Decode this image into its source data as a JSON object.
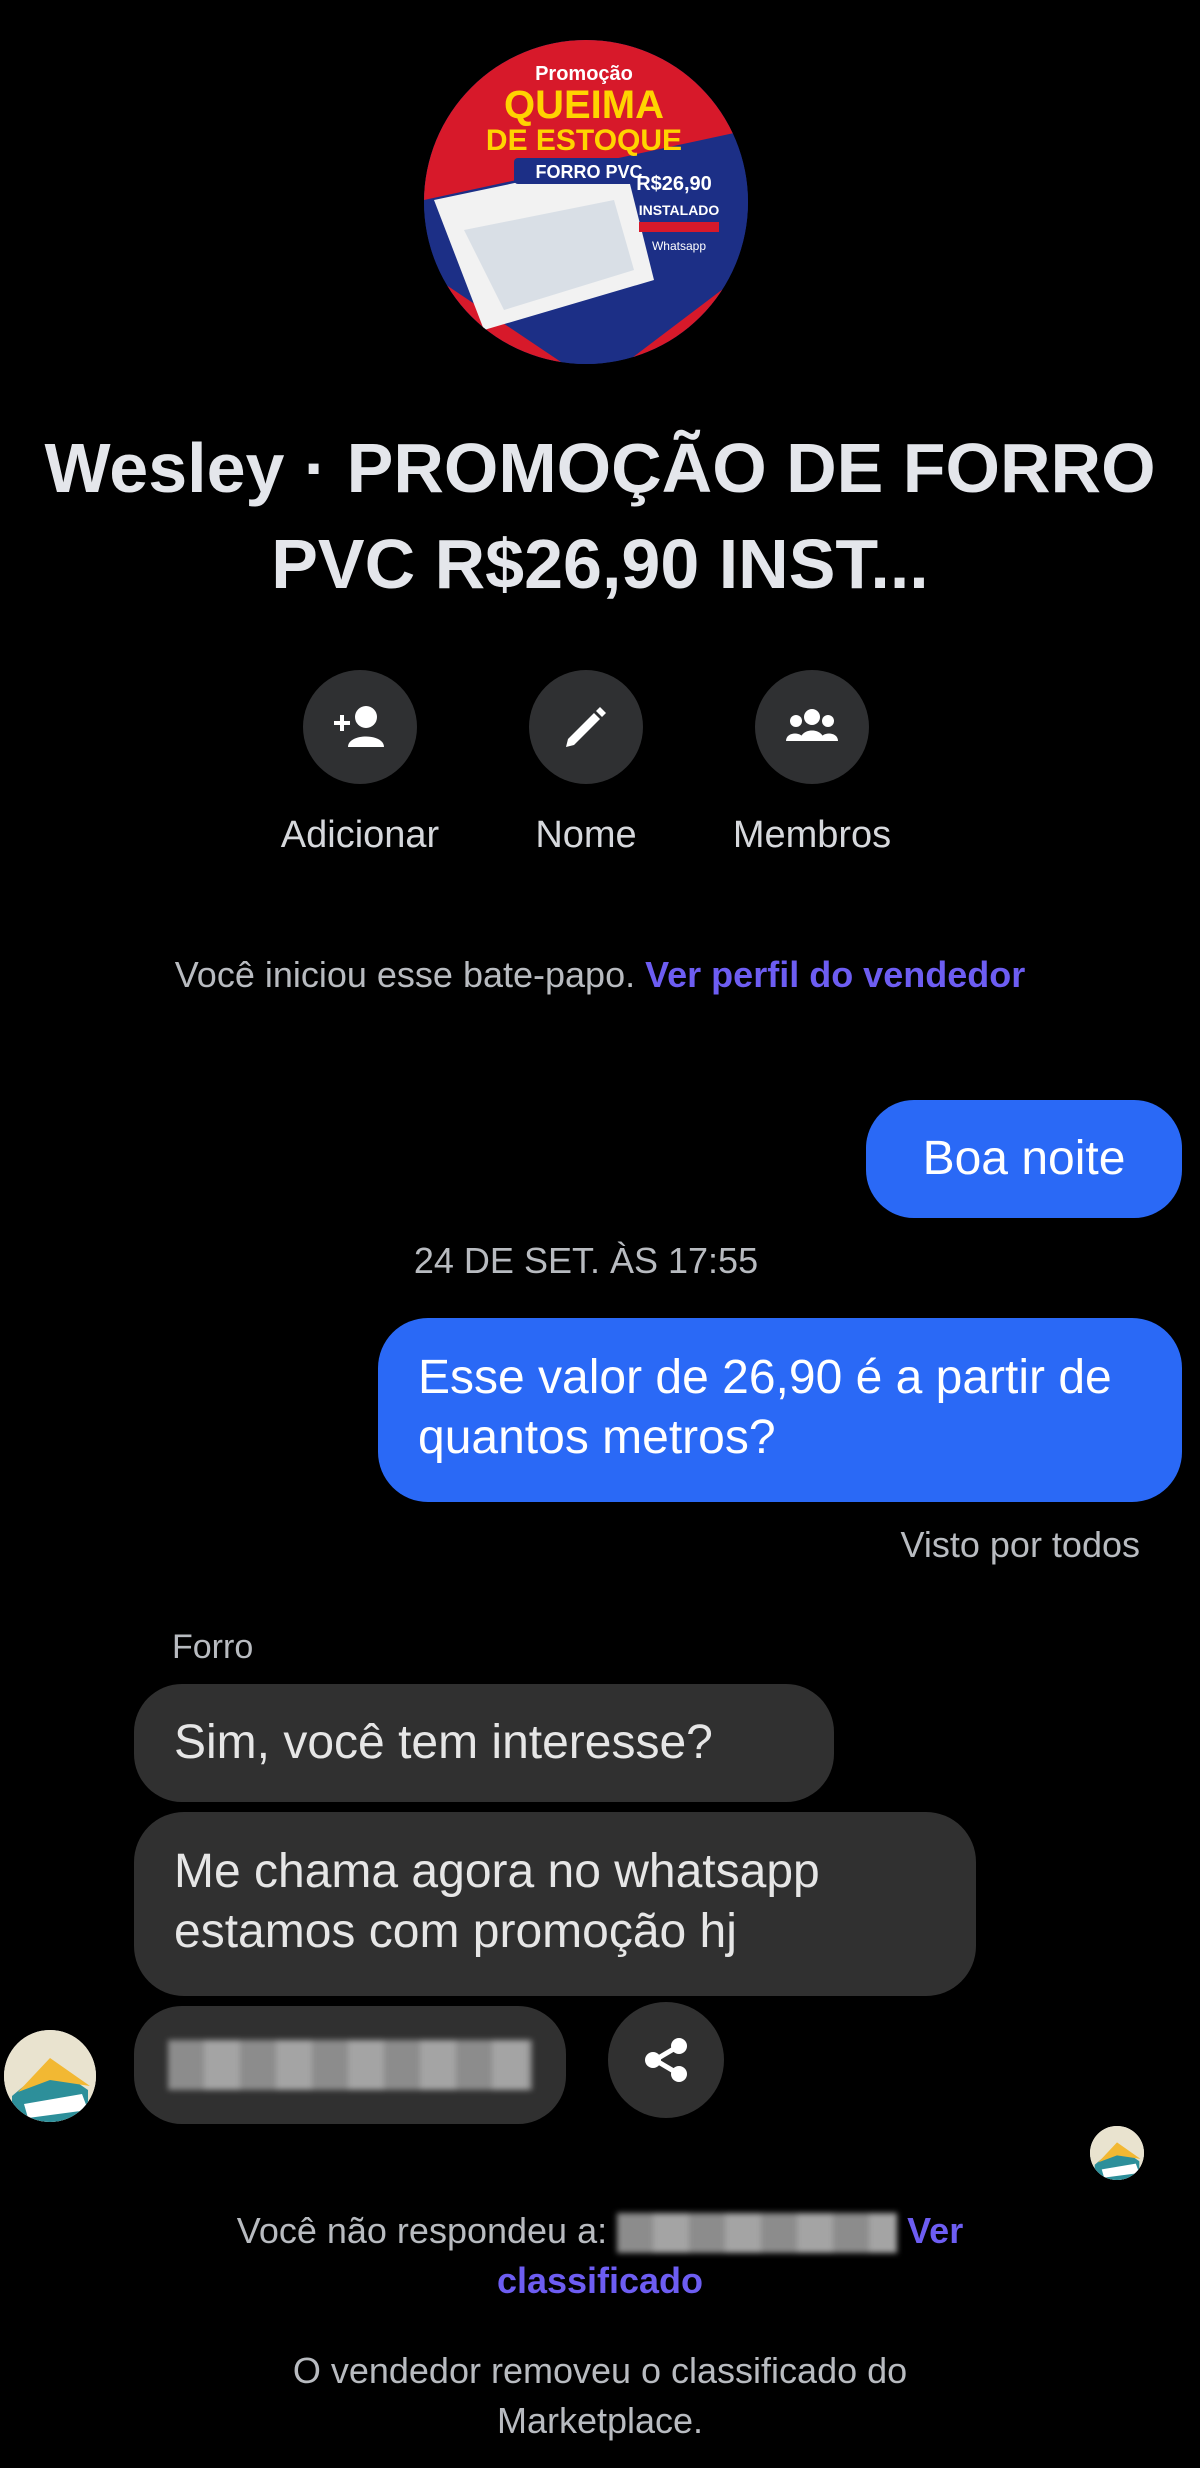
{
  "header": {
    "avatar_text": {
      "line1": "Promoção",
      "line2": "QUEIMA",
      "line3": "DE ESTOQUE",
      "line4": "FORRO PVC",
      "price": "R$26,90",
      "installed": "INSTALADO",
      "whatsapp": "Whatsapp"
    },
    "title": "Wesley · PROMOÇÃO DE FORRO PVC R$26,90 INST..."
  },
  "actions": [
    {
      "label": "Adicionar",
      "icon": "add-person-icon"
    },
    {
      "label": "Nome",
      "icon": "pencil-icon"
    },
    {
      "label": "Membros",
      "icon": "members-icon"
    }
  ],
  "system": {
    "started_text": "Você iniciou esse bate-papo.",
    "view_profile_link": "Ver perfil do vendedor",
    "not_responded_text": "Você não respondeu a:",
    "view_listing_link": "Ver classificado",
    "removed_text": "O vendedor removeu o classificado do Marketplace."
  },
  "messages": {
    "greeting": "Boa noite",
    "timestamp": "24 DE SET. ÀS 17:55",
    "question": "Esse valor de 26,90 é a partir de quantos metros?",
    "seen_status": "Visto por todos",
    "sender_name": "Forro",
    "reply1": "Sim, você tem interesse?",
    "reply2": "Me chama agora no whatsapp estamos com promoção hj"
  },
  "colors": {
    "background": "#000000",
    "outgoing_bubble": "#2a69f6",
    "incoming_bubble": "#303030",
    "link": "#6d5df2"
  }
}
